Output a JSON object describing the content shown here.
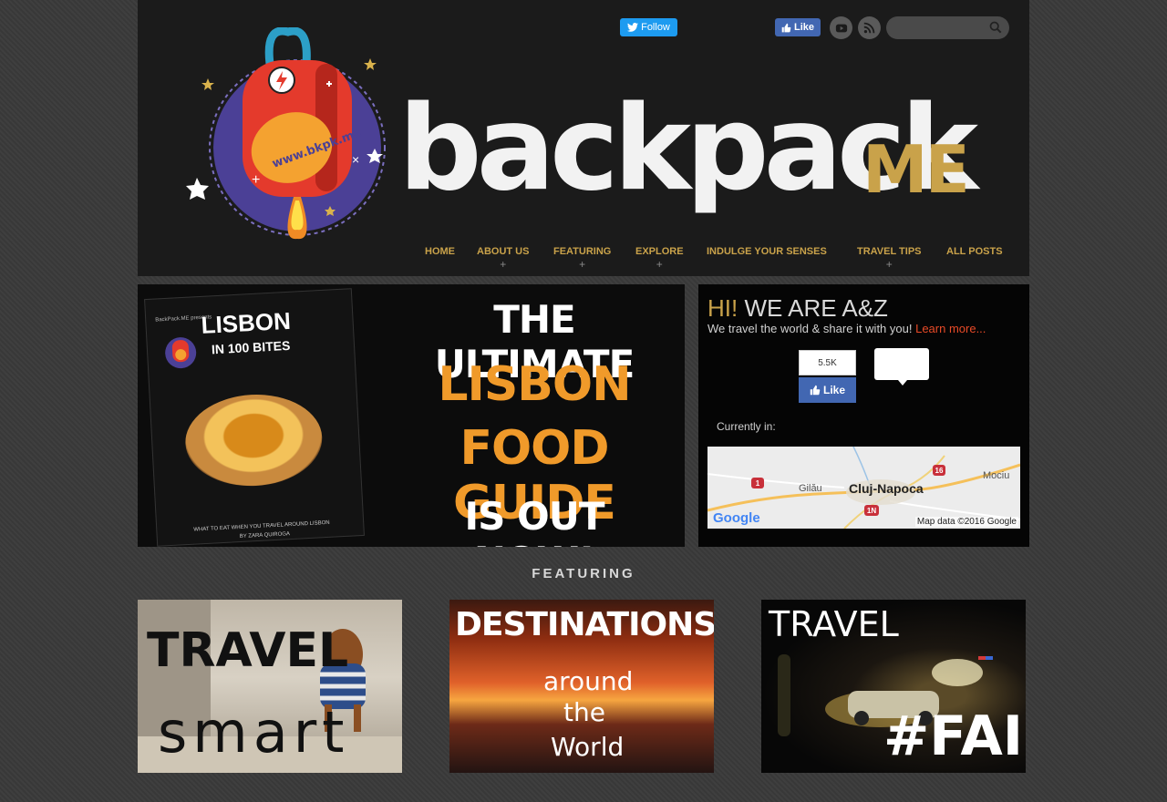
{
  "header": {
    "twitter_follow_label": "Follow",
    "fb_like_label": "Like",
    "search": {
      "placeholder": "",
      "value": ""
    },
    "logo": {
      "badge_text": "www.bkpk.me",
      "wordmark": "backpack",
      "wordmark_suffix": "ME"
    },
    "icons": [
      "youtube-icon",
      "rss-icon",
      "search-icon",
      "twitter-bird-icon",
      "thumbs-up-icon"
    ]
  },
  "nav": {
    "items": [
      {
        "label": "HOME",
        "has_submenu": false
      },
      {
        "label": "ABOUT US",
        "has_submenu": true
      },
      {
        "label": "FEATURING",
        "has_submenu": true
      },
      {
        "label": "EXPLORE",
        "has_submenu": true
      },
      {
        "label": "INDULGE YOUR SENSES",
        "has_submenu": false
      },
      {
        "label": "TRAVEL TIPS",
        "has_submenu": true
      },
      {
        "label": "ALL POSTS",
        "has_submenu": false
      }
    ],
    "submenu_marker": "+"
  },
  "banner": {
    "book": {
      "brand": "BackPack.ME presents",
      "title": "LISBON",
      "subtitle": "IN 100 BITES",
      "footer": "WHAT TO EAT WHEN YOU TRAVEL AROUND LISBON",
      "author": "BY ZARA QUIROGA"
    },
    "line1": "THE ULTIMATE",
    "line2": "LISBON",
    "line3": "FOOD GUIDE",
    "line4": "IS OUT NOW!"
  },
  "sidebar": {
    "hi": "HI!",
    "title_rest": " WE ARE A&Z",
    "intro_text": "We travel the world & share it with you!",
    "learn_more": "Learn more...",
    "fb_count": "5.5K",
    "fb_like_label": "Like",
    "currently_in_label": "Currently in:",
    "map": {
      "city": "Cluj-Napoca",
      "town_west": "Gilău",
      "town_east": "Mociu",
      "shields": [
        "1",
        "16",
        "1N"
      ],
      "provider": "Google",
      "attribution": "Map data ©2016 Google"
    }
  },
  "featuring": {
    "title": "FEATURING",
    "cards": [
      {
        "line1": "TRAVEL",
        "line2": "smart"
      },
      {
        "line1": "DESTINATIONS",
        "line2": "around",
        "line3": "the",
        "line4": "World"
      },
      {
        "line1": "TRAVEL",
        "line2": "#FAIL"
      }
    ]
  },
  "colors": {
    "accent_gold": "#c9a24a",
    "banner_orange": "#f09a2a",
    "learn_more_red": "#e84a27",
    "facebook_blue": "#4267b2",
    "twitter_blue": "#1d9bf0"
  }
}
